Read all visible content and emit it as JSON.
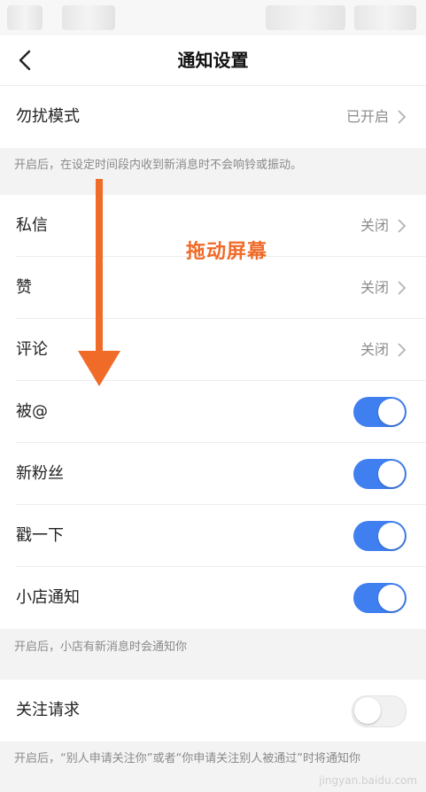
{
  "header": {
    "title": "通知设置"
  },
  "dnd": {
    "label": "勿扰模式",
    "value": "已开启"
  },
  "dnd_note": "开启后，在设定时间段内收到新消息时不会响铃或振动。",
  "rows": [
    {
      "label": "私信",
      "value": "关闭"
    },
    {
      "label": "赞",
      "value": "关闭"
    },
    {
      "label": "评论",
      "value": "关闭"
    }
  ],
  "toggles": [
    {
      "label": "被@",
      "on": true
    },
    {
      "label": "新粉丝",
      "on": true
    },
    {
      "label": "戳一下",
      "on": true
    },
    {
      "label": "小店通知",
      "on": true
    }
  ],
  "shop_note": "开启后，小店有新消息时会通知你",
  "follow": {
    "label": "关注请求",
    "on": false
  },
  "follow_note": "开启后，“别人申请关注你”或者“你申请关注别人被通过”时将通知你",
  "annotation": "拖动屏幕",
  "colors": {
    "toggle_on": "#3f7ff0",
    "annotation": "#f06a28"
  },
  "watermark": "jingyan.baidu.com"
}
